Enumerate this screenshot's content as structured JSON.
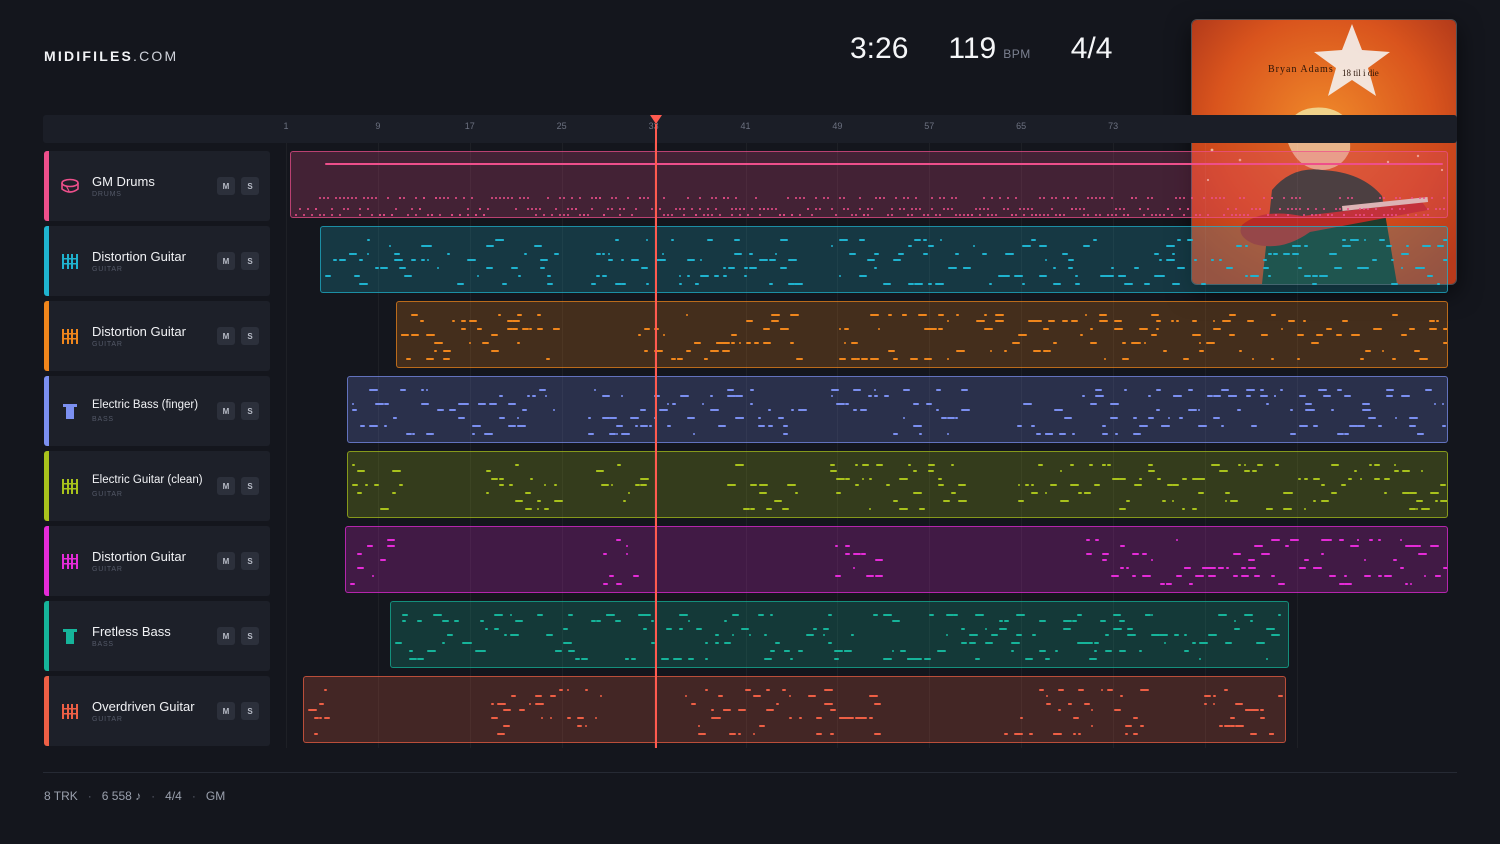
{
  "brand": {
    "bold": "MIDIFILES",
    "light": ".COM"
  },
  "stats": {
    "time": "3:26",
    "bpm": "119",
    "bpm_unit": "BPM",
    "signature": "4/4"
  },
  "cover": {
    "artist": "Bryan Adams",
    "title": "18 til i die"
  },
  "ruler": {
    "ticks": [
      "1",
      "9",
      "17",
      "25",
      "33",
      "41",
      "49",
      "57",
      "65",
      "73"
    ]
  },
  "tracks": [
    {
      "name": "GM Drums",
      "sub": "DRUMS",
      "color": "#ee4f8b",
      "icon": "drum-icon",
      "mute": "M",
      "solo": "S"
    },
    {
      "name": "Distortion Guitar",
      "sub": "GUITAR",
      "color": "#1fb3cf",
      "icon": "guitar-icon",
      "mute": "M",
      "solo": "S"
    },
    {
      "name": "Distortion Guitar",
      "sub": "GUITAR",
      "color": "#f0861c",
      "icon": "guitar-icon",
      "mute": "M",
      "solo": "S"
    },
    {
      "name": "Electric Bass (finger)",
      "sub": "BASS",
      "color": "#7b8ff0",
      "icon": "bass-icon",
      "mute": "M",
      "solo": "S"
    },
    {
      "name": "Electric Guitar (clean)",
      "sub": "GUITAR",
      "color": "#a9c21c",
      "icon": "guitar-icon",
      "mute": "M",
      "solo": "S"
    },
    {
      "name": "Distortion Guitar",
      "sub": "GUITAR",
      "color": "#e52bd8",
      "icon": "guitar-icon",
      "mute": "M",
      "solo": "S"
    },
    {
      "name": "Fretless Bass",
      "sub": "BASS",
      "color": "#16b49a",
      "icon": "bass-icon",
      "mute": "M",
      "solo": "S"
    },
    {
      "name": "Overdriven Guitar",
      "sub": "GUITAR",
      "color": "#ee5f45",
      "icon": "guitar-icon",
      "mute": "M",
      "solo": "S"
    }
  ],
  "footer": {
    "tracks": "8 TRK",
    "notes": "6 558 ♪",
    "signature": "4/4",
    "standard": "GM"
  }
}
